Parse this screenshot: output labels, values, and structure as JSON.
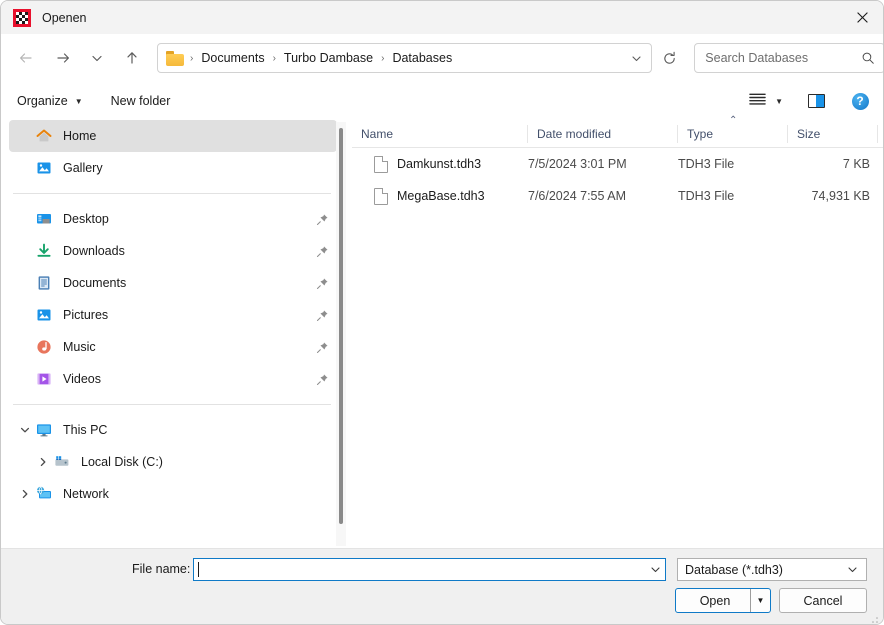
{
  "window": {
    "title": "Openen",
    "app_icon": "checkered-flag-icon",
    "close_label": "✕"
  },
  "nav": {
    "back_icon": "←",
    "forward_icon": "→",
    "recent_icon": "⌄",
    "up_icon": "↑",
    "breadcrumbs": [
      "Documents",
      "Turbo Dambase",
      "Databases"
    ],
    "separator": "›",
    "refresh_icon": "refresh-icon"
  },
  "search": {
    "placeholder": "Search Databases",
    "icon": "search-icon"
  },
  "toolbar": {
    "organize_label": "Organize",
    "organize_caret": "▼",
    "new_folder_label": "New folder",
    "view_icon": "view-list-icon",
    "view_caret": "▼",
    "preview_pane_icon": "preview-pane-icon",
    "help_label": "?"
  },
  "sidebar": {
    "items": [
      {
        "label": "Home",
        "icon": "home-icon",
        "selected": true,
        "pinned": false,
        "level": 1,
        "chevron": ""
      },
      {
        "label": "Gallery",
        "icon": "gallery-icon",
        "selected": false,
        "pinned": false,
        "level": 1,
        "chevron": ""
      },
      {
        "label": "Desktop",
        "icon": "desktop-icon",
        "selected": false,
        "pinned": true,
        "level": 1,
        "chevron": ""
      },
      {
        "label": "Downloads",
        "icon": "downloads-icon",
        "selected": false,
        "pinned": true,
        "level": 1,
        "chevron": ""
      },
      {
        "label": "Documents",
        "icon": "documents-icon",
        "selected": false,
        "pinned": true,
        "level": 1,
        "chevron": ""
      },
      {
        "label": "Pictures",
        "icon": "pictures-icon",
        "selected": false,
        "pinned": true,
        "level": 1,
        "chevron": ""
      },
      {
        "label": "Music",
        "icon": "music-icon",
        "selected": false,
        "pinned": true,
        "level": 1,
        "chevron": ""
      },
      {
        "label": "Videos",
        "icon": "videos-icon",
        "selected": false,
        "pinned": true,
        "level": 1,
        "chevron": ""
      },
      {
        "label": "This PC",
        "icon": "this-pc-icon",
        "selected": false,
        "pinned": false,
        "level": 1,
        "chevron": "⌄"
      },
      {
        "label": "Local Disk (C:)",
        "icon": "local-disk-icon",
        "selected": false,
        "pinned": false,
        "level": 2,
        "chevron": "›"
      },
      {
        "label": "Network",
        "icon": "network-icon",
        "selected": false,
        "pinned": false,
        "level": 1,
        "chevron": "›"
      }
    ],
    "pin_icon": "pin-icon"
  },
  "filelist": {
    "columns": [
      "Name",
      "Date modified",
      "Type",
      "Size"
    ],
    "sort_indicator": "⌃",
    "rows": [
      {
        "name": "Damkunst.tdh3",
        "date": "7/5/2024 3:01 PM",
        "type": "TDH3 File",
        "size": "7 KB"
      },
      {
        "name": "MegaBase.tdh3",
        "date": "7/6/2024 7:55 AM",
        "type": "TDH3 File",
        "size": "74,931 KB"
      }
    ]
  },
  "footer": {
    "filename_label": "File name:",
    "filename_value": "",
    "filename_placeholder": "",
    "filetype_value": "Database (*.tdh3)",
    "filetype_chevron": "⌄",
    "open_label": "Open",
    "open_split_caret": "▼",
    "cancel_label": "Cancel"
  },
  "colors": {
    "accent": "#0f7ac7",
    "titlebar_bg": "#f3f3f3",
    "footer_bg": "#f0f0f0",
    "selection": "#e0e0e0",
    "app_icon_red": "#e8112d"
  }
}
